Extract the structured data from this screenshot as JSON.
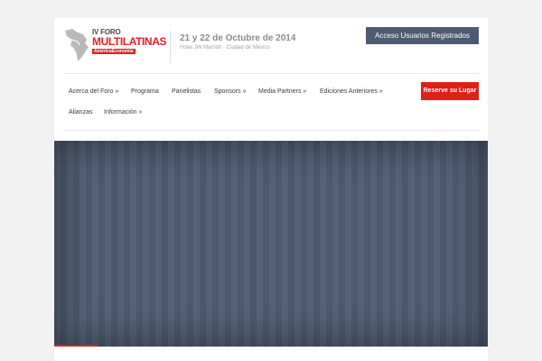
{
  "header": {
    "logo": {
      "line1": "IV FORO",
      "line2": "MULTILATINAS",
      "badge": "AméricaEconomía"
    },
    "event_date": "21 y 22 de Octubre de 2014",
    "event_venue": "Hotel JW Marriott · Ciudad de México",
    "login_label": "Acceso Usuarios Registrados"
  },
  "nav": {
    "items": [
      "Acerca del Foro »",
      "Programa",
      "Panelistas",
      "Sponsors »",
      "Media Partners »",
      "Ediciones Anteriores »",
      "Alianzas",
      "Información »"
    ],
    "reserve_label": "Reserve su Lugar"
  },
  "hero": {
    "progress": 0.1
  },
  "colors": {
    "brand_red": "#dc2119",
    "login_bg": "#4d5a73",
    "hero_bg": "#4e5b72"
  }
}
